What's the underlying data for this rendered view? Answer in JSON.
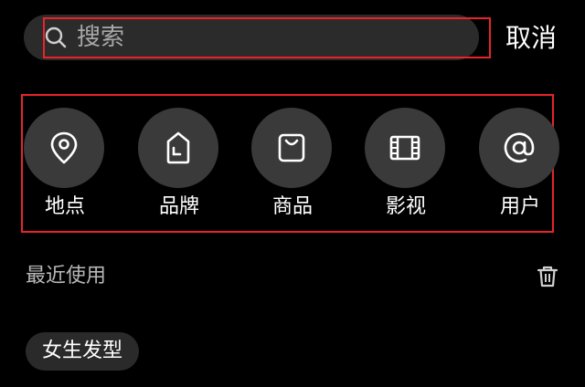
{
  "search": {
    "placeholder": "搜索",
    "cancel_label": "取消"
  },
  "categories": [
    {
      "label": "地点",
      "icon": "location-pin-icon"
    },
    {
      "label": "品牌",
      "icon": "brand-tag-icon"
    },
    {
      "label": "商品",
      "icon": "shopping-bag-icon"
    },
    {
      "label": "影视",
      "icon": "film-icon"
    },
    {
      "label": "用户",
      "icon": "at-sign-icon"
    }
  ],
  "recent": {
    "title": "最近使用",
    "items": [
      "女生发型"
    ]
  },
  "colors": {
    "background": "#000000",
    "highlight": "#e8242a",
    "circle": "#3a3a3a",
    "pill": "#2b2b2b"
  }
}
